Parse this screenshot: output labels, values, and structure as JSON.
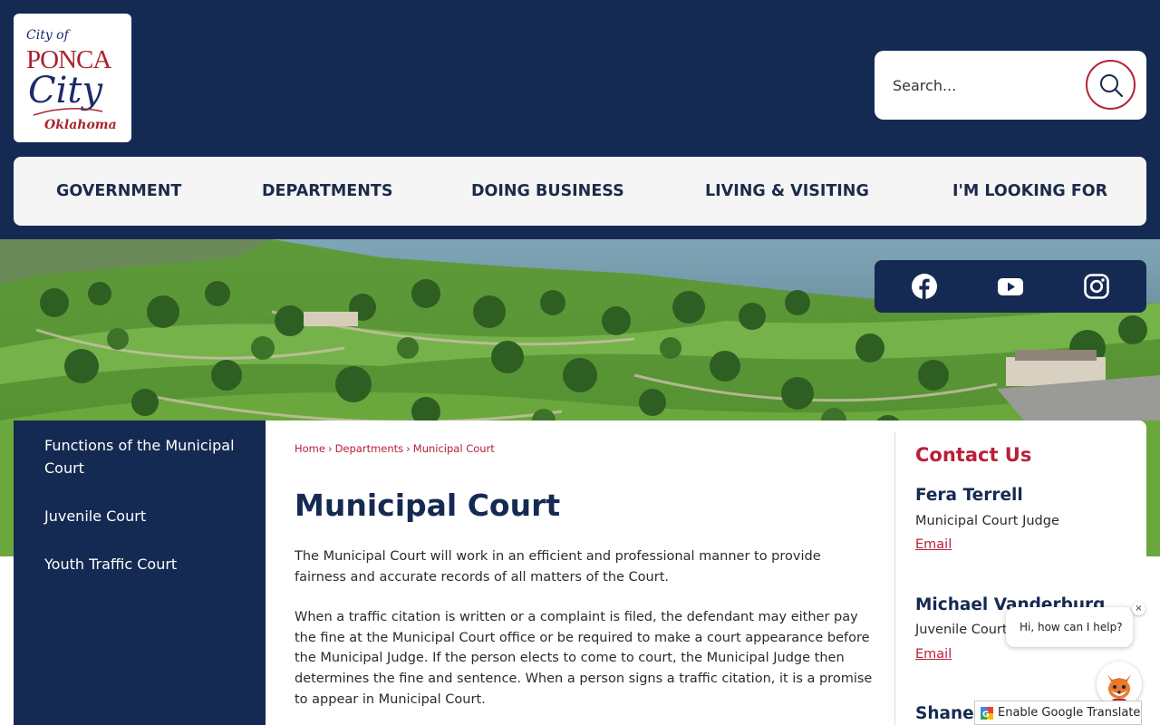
{
  "logo": {
    "line1": "City of",
    "line2": "PONCA",
    "line3": "City",
    "line4": "Oklahoma"
  },
  "search": {
    "placeholder": "Search..."
  },
  "nav": {
    "items": [
      {
        "label": "GOVERNMENT"
      },
      {
        "label": "DEPARTMENTS"
      },
      {
        "label": "DOING BUSINESS"
      },
      {
        "label": "LIVING & VISITING"
      },
      {
        "label": "I'M LOOKING FOR"
      }
    ]
  },
  "social": {
    "icons": [
      "facebook-icon",
      "youtube-icon",
      "instagram-icon"
    ]
  },
  "sidebar": {
    "items": [
      {
        "label": "Functions of the Municipal Court"
      },
      {
        "label": "Juvenile Court"
      },
      {
        "label": "Youth Traffic Court"
      }
    ]
  },
  "breadcrumb": {
    "items": [
      "Home",
      "Departments",
      "Municipal Court"
    ],
    "separator": "›"
  },
  "main": {
    "title": "Municipal Court",
    "paragraphs": [
      "The Municipal Court will work in an efficient and professional manner to provide fairness and accurate records of all matters of the Court.",
      "When a traffic citation is written or a complaint is filed, the defendant may either pay the fine at the Municipal Court office or be required to make a court appearance before the Municipal Judge. If the person elects to come to court, the Municipal Judge then determines the fine and sentence. When a person signs a traffic citation, it is a promise to appear in Municipal Court."
    ]
  },
  "contact": {
    "title": "Contact Us",
    "people": [
      {
        "name": "Fera Terrell",
        "role": "Municipal Court Judge",
        "email_label": "Email"
      },
      {
        "name": "Michael Vanderburg",
        "role": "Juvenile Court",
        "email_label": "Email"
      },
      {
        "name": "Shane"
      }
    ]
  },
  "chat": {
    "greeting": "Hi, how can I help?",
    "close": "×"
  },
  "translate": {
    "label": "Enable Google Translate"
  },
  "colors": {
    "navy": "#152a52",
    "accent_red": "#b8203a",
    "nav_bg": "#f5f5f5"
  }
}
